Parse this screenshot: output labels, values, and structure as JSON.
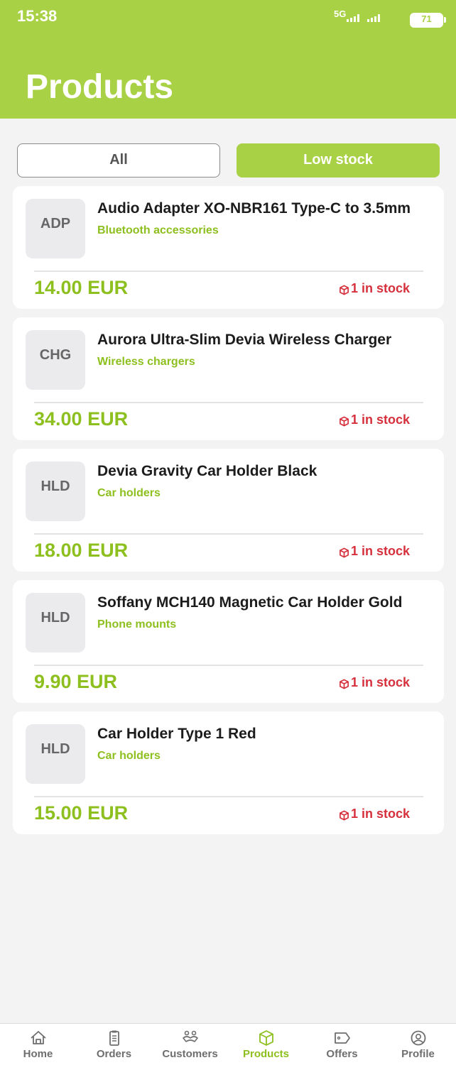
{
  "status_bar": {
    "time": "15:38",
    "network": "5G",
    "battery": "71"
  },
  "header": {
    "title": "Products"
  },
  "filters": {
    "all_label": "All",
    "low_stock_label": "Low stock",
    "active": "low_stock"
  },
  "products": [
    {
      "code": "ADP",
      "name": "Audio Adapter XO-NBR161 Type-C to 3.5mm",
      "category": "Bluetooth accessories",
      "price": "14.00 EUR",
      "stock": "1 in stock"
    },
    {
      "code": "CHG",
      "name": "Aurora Ultra-Slim Devia Wireless Charger",
      "category": "Wireless chargers",
      "price": "34.00 EUR",
      "stock": "1 in stock"
    },
    {
      "code": "HLD",
      "name": "Devia Gravity Car Holder Black",
      "category": "Car holders",
      "price": "18.00 EUR",
      "stock": "1 in stock"
    },
    {
      "code": "HLD",
      "name": "Soffany MCH140 Magnetic Car Holder Gold",
      "category": "Phone mounts",
      "price": "9.90 EUR",
      "stock": "1 in stock"
    },
    {
      "code": "HLD",
      "name": "Car Holder Type 1 Red",
      "category": "Car holders",
      "price": "15.00 EUR",
      "stock": "1 in stock"
    }
  ],
  "nav": {
    "items": [
      {
        "label": "Home",
        "icon": "home-icon"
      },
      {
        "label": "Orders",
        "icon": "clipboard-icon"
      },
      {
        "label": "Customers",
        "icon": "handshake-icon"
      },
      {
        "label": "Products",
        "icon": "box-icon"
      },
      {
        "label": "Offers",
        "icon": "tag-icon"
      },
      {
        "label": "Profile",
        "icon": "user-circle-icon"
      }
    ],
    "active": "Products"
  },
  "colors": {
    "brand": "#a8d145",
    "accent_text": "#8dbf1e",
    "stock_alert": "#d6303c",
    "background": "#f3f3f3"
  }
}
